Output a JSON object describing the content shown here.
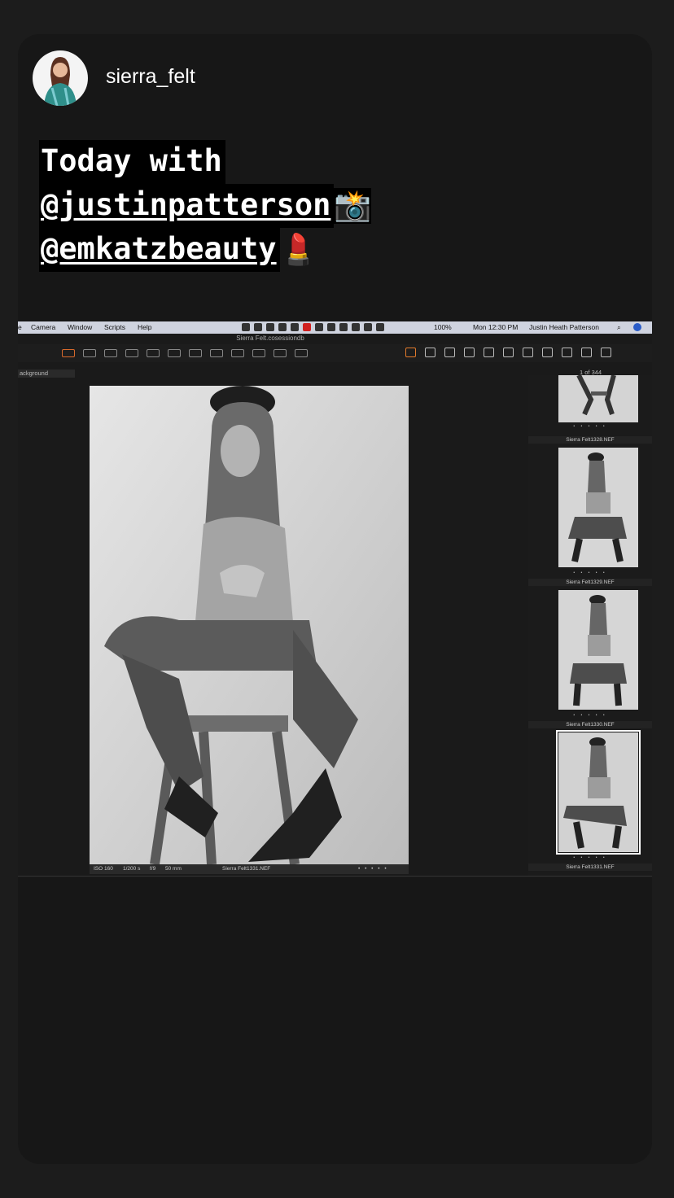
{
  "story": {
    "username": "sierra_felt",
    "caption_line1": "Today with",
    "mention1": "@justinpatterson",
    "emoji1": "📸",
    "mention2": "@emkatzbeauty",
    "emoji2": "💄"
  },
  "capture_window": {
    "menu": [
      "e",
      "Camera",
      "Window",
      "Scripts",
      "Help"
    ],
    "status_battery": "100%",
    "clock": "Mon 12:30 PM",
    "user": "Justin Heath Patterson",
    "document_title": "Sierra Felt.cosessiondb",
    "background_field": "ackground",
    "counter": "1 of 344",
    "meta": {
      "iso": "ISO 160",
      "shutter": "1/200 s",
      "aperture": "f/9",
      "focal": "50 mm",
      "filename": "Sierra Felt1331.NEF"
    },
    "thumbnails": [
      {
        "label": "Sierra Felt1328.NEF"
      },
      {
        "label": "Sierra Felt1329.NEF"
      },
      {
        "label": "Sierra Felt1330.NEF"
      },
      {
        "label": "Sierra Felt1331.NEF",
        "selected": true
      }
    ],
    "rating_dots": "• • • • •"
  }
}
